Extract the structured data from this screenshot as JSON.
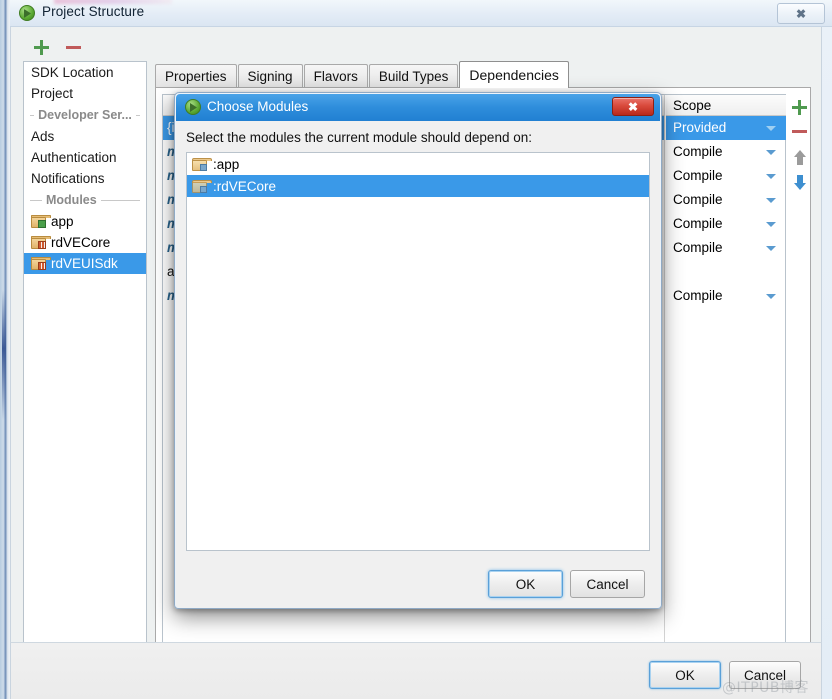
{
  "window": {
    "title": "Project Structure",
    "icon": "android-studio-icon",
    "close_label": "✕"
  },
  "toolbar": {
    "add_icon": "plus-icon",
    "remove_icon": "minus-icon"
  },
  "sidebar": {
    "items": [
      {
        "label": "SDK Location",
        "type": "item"
      },
      {
        "label": "Project",
        "type": "item"
      },
      {
        "label": "Developer Ser...",
        "type": "group"
      },
      {
        "label": "Ads",
        "type": "item"
      },
      {
        "label": "Authentication",
        "type": "item"
      },
      {
        "label": "Notifications",
        "type": "item"
      }
    ],
    "modules_separator": "Modules",
    "modules": [
      {
        "label": "app",
        "selected": false,
        "icon": "module-app-icon"
      },
      {
        "label": "rdVECore",
        "selected": false,
        "icon": "module-library-icon"
      },
      {
        "label": "rdVEUISdk",
        "selected": true,
        "icon": "module-library-icon"
      }
    ]
  },
  "tabs": [
    {
      "label": "Properties",
      "active": false
    },
    {
      "label": "Signing",
      "active": false
    },
    {
      "label": "Flavors",
      "active": false
    },
    {
      "label": "Build Types",
      "active": false
    },
    {
      "label": "Dependencies",
      "active": true
    }
  ],
  "dependencies_table": {
    "scope_header": "Scope",
    "rows": [
      {
        "name": "{in",
        "scope": "Provided",
        "selected": true,
        "has_caret": false
      },
      {
        "name": "m",
        "scope": "Compile",
        "selected": false,
        "has_caret": true
      },
      {
        "name": "m",
        "scope": "Compile",
        "selected": false,
        "has_caret": true
      },
      {
        "name": "m",
        "scope": "Compile",
        "selected": false,
        "has_caret": true
      },
      {
        "name": "m",
        "scope": "Compile",
        "selected": false,
        "has_caret": true
      },
      {
        "name": "m",
        "scope": "Compile",
        "selected": false,
        "has_caret": true
      },
      {
        "name": "an",
        "scope": "",
        "selected": false,
        "has_caret": false
      },
      {
        "name": "m",
        "scope": "Compile",
        "selected": false,
        "has_caret": true
      }
    ],
    "tools": {
      "add_icon": "plus-icon",
      "remove_icon": "minus-icon",
      "move_up_icon": "arrow-up-icon",
      "move_down_icon": "arrow-down-icon"
    }
  },
  "dialog": {
    "title": "Choose Modules",
    "icon": "android-studio-icon",
    "close_label": "✕",
    "prompt": "Select the modules the current module should depend on:",
    "modules": [
      {
        "label": ":app",
        "selected": false
      },
      {
        "label": ":rdVECore",
        "selected": true
      }
    ],
    "ok_label": "OK",
    "cancel_label": "Cancel"
  },
  "footer": {
    "ok_label": "OK",
    "cancel_label": "Cancel",
    "watermark": "@ITPUB博客"
  }
}
